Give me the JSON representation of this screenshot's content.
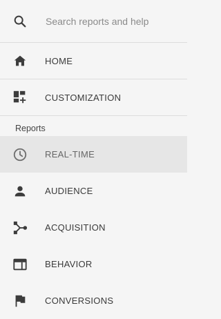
{
  "search": {
    "placeholder": "Search reports and help",
    "icon": "search-icon"
  },
  "top_items": [
    {
      "label": "HOME",
      "icon": "home-icon"
    },
    {
      "label": "CUSTOMIZATION",
      "icon": "dashboard-add-icon"
    }
  ],
  "reports": {
    "header": "Reports",
    "items": [
      {
        "label": "REAL-TIME",
        "icon": "clock-icon",
        "active": true
      },
      {
        "label": "AUDIENCE",
        "icon": "person-icon",
        "active": false
      },
      {
        "label": "ACQUISITION",
        "icon": "acquisition-icon",
        "active": false
      },
      {
        "label": "BEHAVIOR",
        "icon": "browser-window-icon",
        "active": false
      },
      {
        "label": "CONVERSIONS",
        "icon": "flag-icon",
        "active": false
      }
    ]
  },
  "colors": {
    "background": "#f5f5f5",
    "active_background": "#e6e6e6",
    "divider": "#dcdcdc",
    "icon": "#3c3c3c",
    "active_icon": "#6f6f6f"
  }
}
